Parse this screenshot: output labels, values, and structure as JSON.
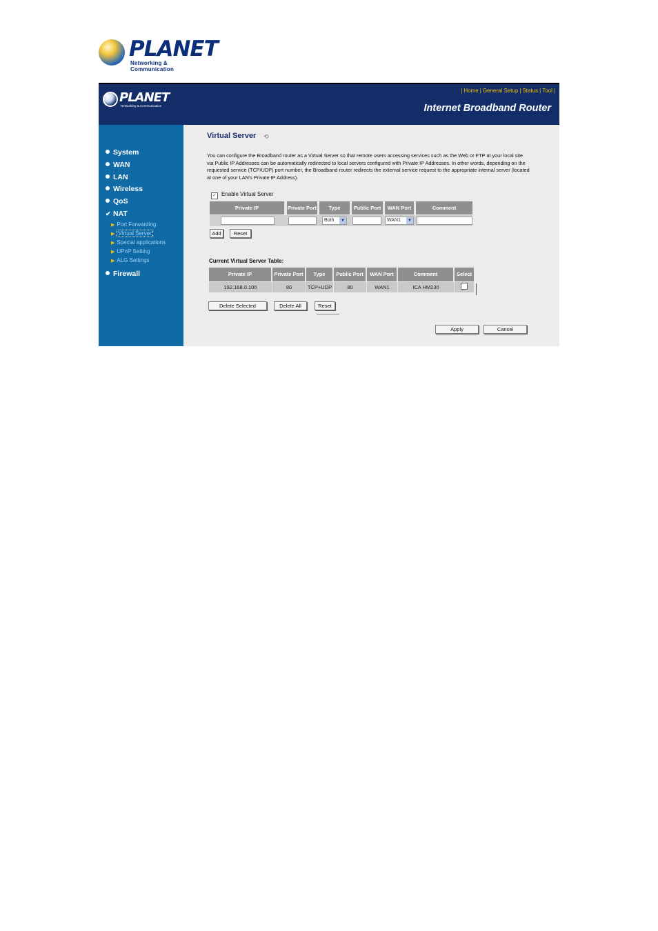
{
  "logo": {
    "word": "PLANET",
    "tagline": "Networking & Communication"
  },
  "header": {
    "logo_word": "PLANET",
    "logo_tagline": "Networking & Communication",
    "nav": [
      "Home",
      "General Setup",
      "Status",
      "Tool"
    ],
    "product_title": "Internet Broadband Router"
  },
  "sidebar": {
    "items": [
      {
        "label": "System"
      },
      {
        "label": "WAN"
      },
      {
        "label": "LAN"
      },
      {
        "label": "Wireless"
      },
      {
        "label": "QoS"
      },
      {
        "label": "NAT"
      },
      {
        "label": "Firewall"
      }
    ],
    "nat_sub": [
      {
        "label": "Port Forwarding"
      },
      {
        "label": "Virtual Server"
      },
      {
        "label": "Special applications"
      },
      {
        "label": "UPnP Setting"
      },
      {
        "label": "ALG Settings"
      }
    ]
  },
  "content": {
    "title": "Virtual Server",
    "description": "You can configure the Broadband router as a Virtual Server so that remote users accessing services such as the Web or FTP at your local site via Public IP Addresses can be automatically redirected to local servers configured with Private IP Addresses. In other words, depending on the requested service (TCP/UDP) port number, the Broadband router redirects the external service request to the appropriate internal server (located at one of your LAN's Private IP Address).",
    "enable_label": "Enable Virtual Server",
    "enable_checked": true,
    "form_headers": [
      "Private IP",
      "Private Port",
      "Type",
      "Public Port",
      "WAN Port",
      "Comment"
    ],
    "form": {
      "private_ip": "",
      "private_port": "",
      "type": "Both",
      "public_port": "",
      "wan_port": "WAN1",
      "comment": ""
    },
    "add_label": "Add",
    "reset_label": "Reset",
    "table_title": "Current Virtual Server Table:",
    "table_headers": [
      "Private IP",
      "Private Port",
      "Type",
      "Public Port",
      "WAN Port",
      "Comment",
      "Select"
    ],
    "rows": [
      {
        "private_ip": "192.168.0.100",
        "private_port": "80",
        "type": "TCP+UDP",
        "public_port": "80",
        "wan_port": "WAN1",
        "comment": "ICA HM230",
        "selected": false
      }
    ],
    "delete_selected_label": "Delete Selected",
    "delete_all_label": "Delete All",
    "table_reset_label": "Reset",
    "apply_label": "Apply",
    "cancel_label": "Cancel"
  }
}
